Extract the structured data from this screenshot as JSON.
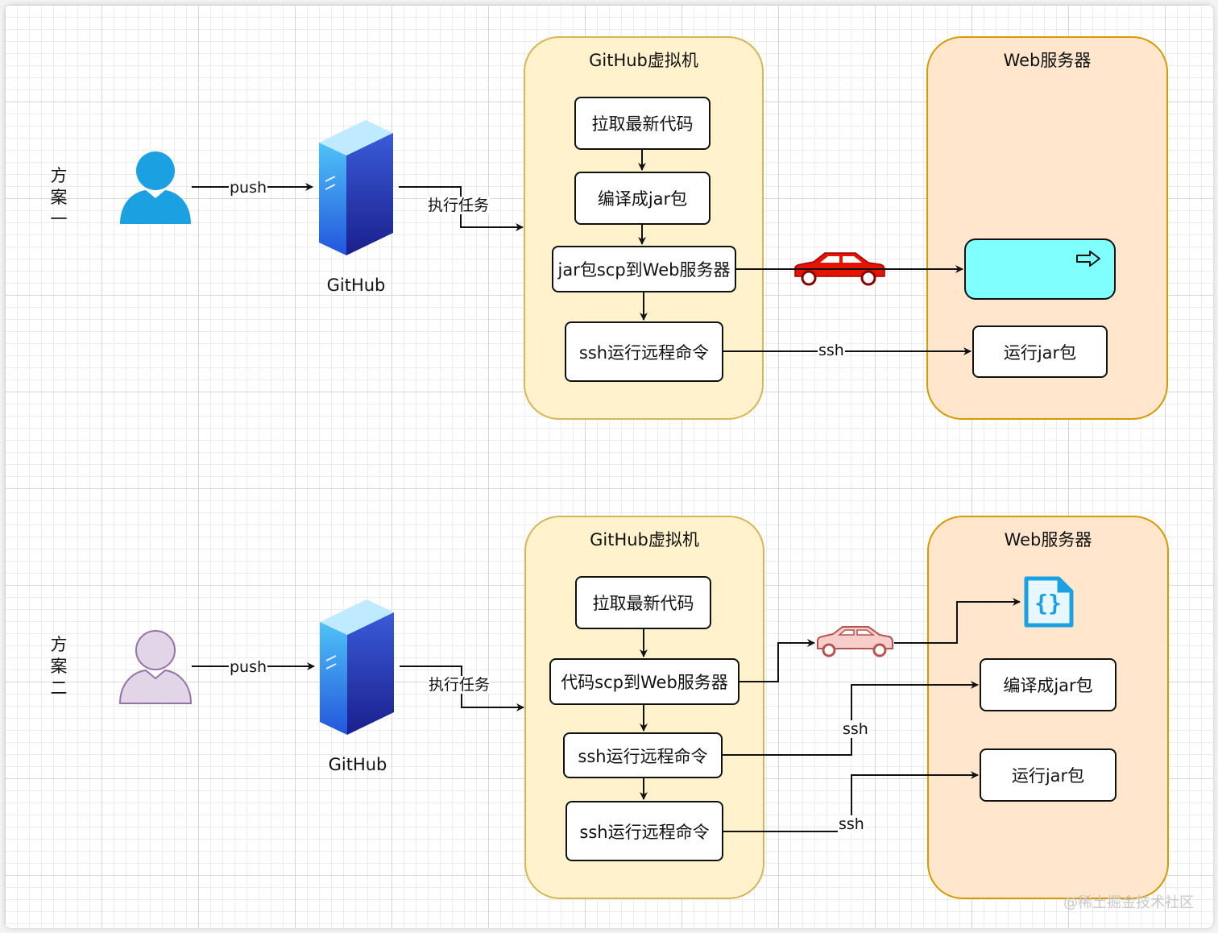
{
  "plan1": {
    "label": "方案一",
    "edge_push": "push",
    "server_label": "GitHub",
    "edge_task": "执行任务",
    "vm": {
      "title": "GitHub虚拟机",
      "steps": [
        "拉取最新代码",
        "编译成jar包",
        "jar包scp到Web服务器",
        "ssh运行远程命令"
      ]
    },
    "web": {
      "title": "Web服务器",
      "step_run": "运行jar包"
    },
    "edge_ssh": "ssh"
  },
  "plan2": {
    "label": "方案二",
    "edge_push": "push",
    "server_label": "GitHub",
    "edge_task": "执行任务",
    "vm": {
      "title": "GitHub虚拟机",
      "steps": [
        "拉取最新代码",
        "代码scp到Web服务器",
        "ssh运行远程命令",
        "ssh运行远程命令"
      ]
    },
    "web": {
      "title": "Web服务器",
      "step_build": "编译成jar包",
      "step_run": "运行jar包"
    },
    "edge_ssh_1": "ssh",
    "edge_ssh_2": "ssh"
  },
  "watermark": "@稀土掘金技术社区",
  "colors": {
    "vm_fill": "#fff2cc",
    "vm_border": "#d6b656",
    "web_fill": "#ffe6cc",
    "web_border": "#d79b00",
    "user1": "#1ba1e2",
    "user2_fill": "#e1d5e7",
    "user2_border": "#9673a6",
    "car1": "#e51400",
    "car2": "#f8cecc",
    "car2_border": "#b85450",
    "jar_box": "#80ffff",
    "file_icon": "#1ba1e2"
  }
}
